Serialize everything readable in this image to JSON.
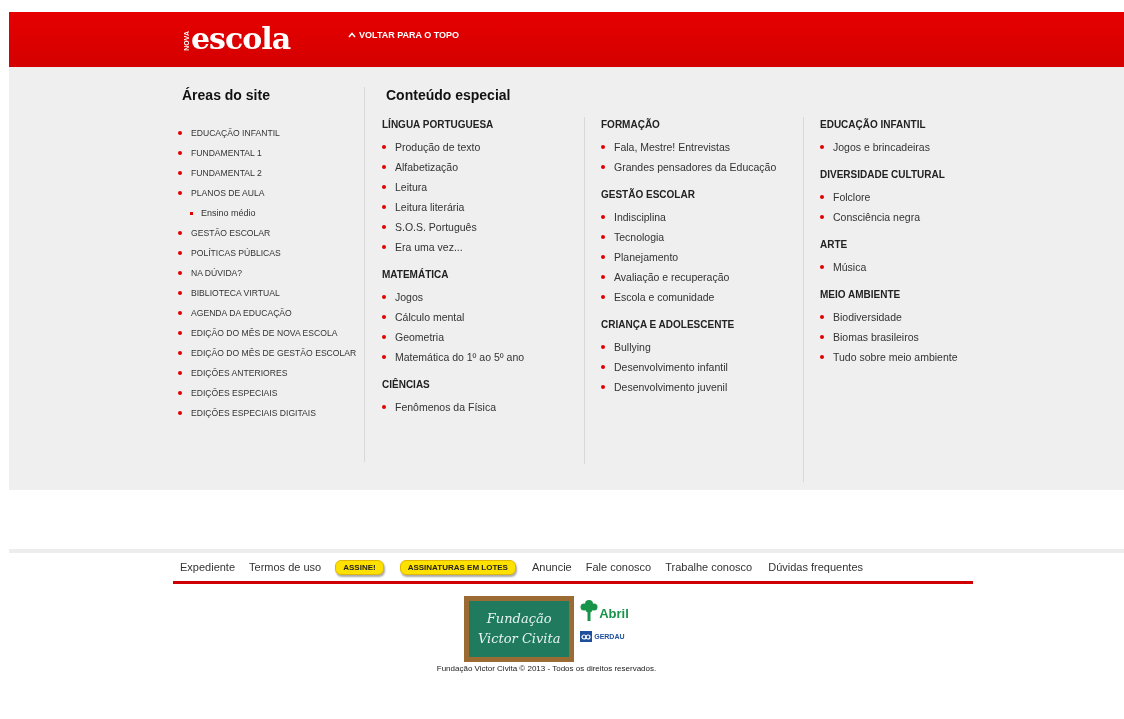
{
  "header": {
    "logo": {
      "small": "NOVA",
      "main": "escola"
    },
    "back_to_top": "VOLTAR PARA O TOPO"
  },
  "areas": {
    "title": "Áreas do site",
    "items": [
      {
        "label": "EDUCAÇÃO INFANTIL"
      },
      {
        "label": "FUNDAMENTAL 1"
      },
      {
        "label": "FUNDAMENTAL 2"
      },
      {
        "label": "PLANOS DE AULA",
        "children": [
          {
            "label": "Ensino médio"
          }
        ]
      },
      {
        "label": "GESTÃO ESCOLAR"
      },
      {
        "label": "POLÍTICAS PÚBLICAS"
      },
      {
        "label": "NA DÚVIDA?"
      },
      {
        "label": "BIBLIOTECA VIRTUAL"
      },
      {
        "label": "AGENDA DA EDUCAÇÃO"
      },
      {
        "label": "EDIÇÃO DO MÊS DE NOVA ESCOLA"
      },
      {
        "label": "EDIÇÃO DO MÊS DE GESTÃO ESCOLAR"
      },
      {
        "label": "EDIÇÕES ANTERIORES"
      },
      {
        "label": "EDIÇÕES ESPECIAIS"
      },
      {
        "label": "EDIÇÕES ESPECIAIS DIGITAIS"
      }
    ]
  },
  "special": {
    "title": "Conteúdo especial",
    "columns": [
      [
        {
          "heading": "LÍNGUA PORTUGUESA",
          "items": [
            "Produção de texto",
            "Alfabetização",
            "Leitura",
            "Leitura literária",
            "S.O.S. Português",
            "Era uma vez..."
          ]
        },
        {
          "heading": "MATEMÁTICA",
          "items": [
            "Jogos",
            "Cálculo mental",
            "Geometria",
            "Matemática do 1º ao 5º ano"
          ]
        },
        {
          "heading": "CIÊNCIAS",
          "items": [
            "Fenômenos da Física"
          ]
        }
      ],
      [
        {
          "heading": "FORMAÇÃO",
          "items": [
            "Fala, Mestre! Entrevistas",
            "Grandes pensadores da Educação"
          ]
        },
        {
          "heading": "GESTÃO ESCOLAR",
          "items": [
            "Indisciplina",
            "Tecnologia",
            "Planejamento",
            "Avaliação e recuperação",
            "Escola e comunidade"
          ]
        },
        {
          "heading": "CRIANÇA E ADOLESCENTE",
          "items": [
            "Bullying",
            "Desenvolvimento infantil",
            "Desenvolvimento juvenil"
          ]
        }
      ],
      [
        {
          "heading": "EDUCAÇÃO INFANTIL",
          "items": [
            "Jogos e brincadeiras"
          ]
        },
        {
          "heading": "DIVERSIDADE CULTURAL",
          "items": [
            "Folclore",
            "Consciência negra"
          ]
        },
        {
          "heading": "ARTE",
          "items": [
            "Música"
          ]
        },
        {
          "heading": "MEIO AMBIENTE",
          "items": [
            "Biodiversidade",
            "Biomas brasileiros",
            "Tudo sobre meio ambiente"
          ]
        }
      ]
    ]
  },
  "footer": {
    "links": [
      {
        "kind": "link",
        "label": "Expediente"
      },
      {
        "kind": "link",
        "label": "Termos de uso"
      },
      {
        "kind": "badge",
        "label": "ASSINE!"
      },
      {
        "kind": "badge",
        "label": "ASSINATURAS EM LOTES"
      },
      {
        "kind": "link",
        "label": "Anuncie"
      },
      {
        "kind": "link",
        "label": "Fale conosco"
      },
      {
        "kind": "link",
        "label": "Trabalhe conosco"
      },
      {
        "kind": "link",
        "label": "Dúvidas frequentes"
      }
    ],
    "board": [
      "Fundação",
      "Victor Civita"
    ],
    "abril": "Abril",
    "gerdau": "GERDAU",
    "copyright": "Fundação Victor Civita © 2013 - Todos os direitos reservados."
  }
}
